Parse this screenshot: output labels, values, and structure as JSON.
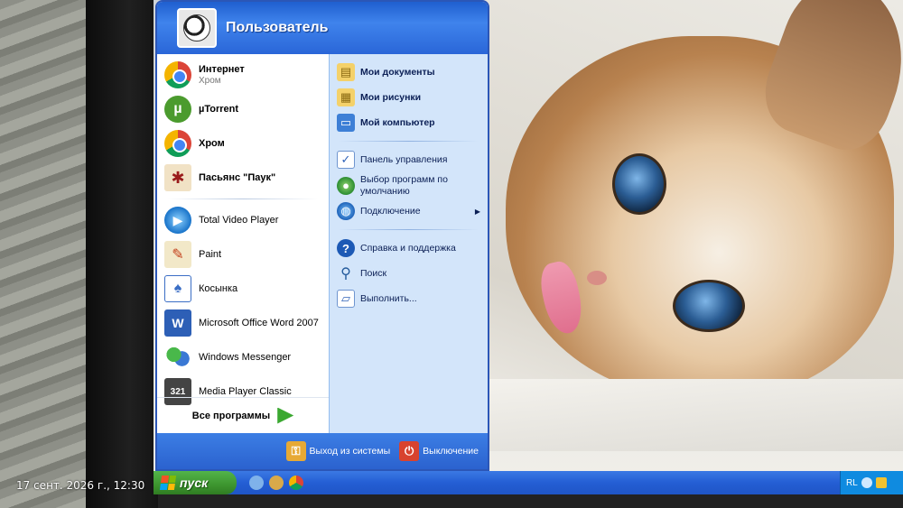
{
  "start_menu": {
    "user_name": "Пользователь",
    "pinned": [
      {
        "title": "Интернет",
        "subtitle": "Хром",
        "icon": "chrome-icon"
      },
      {
        "title": "µTorrent",
        "icon": "utorrent-icon"
      },
      {
        "title": "Хром",
        "icon": "chrome-icon"
      },
      {
        "title": "Пасьянс \"Паук\"",
        "icon": "spider-solitaire-icon"
      }
    ],
    "recent": [
      {
        "title": "Total Video Player",
        "icon": "video-player-icon"
      },
      {
        "title": "Paint",
        "icon": "paint-icon"
      },
      {
        "title": "Косынка",
        "icon": "solitaire-icon"
      },
      {
        "title": "Microsoft Office Word 2007",
        "icon": "word-icon"
      },
      {
        "title": "Windows Messenger",
        "icon": "messenger-icon"
      },
      {
        "title": "Media Player Classic",
        "icon": "media-player-icon"
      }
    ],
    "all_programs": "Все программы",
    "places": [
      {
        "label": "Мои документы",
        "icon": "documents-folder-icon"
      },
      {
        "label": "Мои рисунки",
        "icon": "pictures-folder-icon"
      },
      {
        "label": "Мой компьютер",
        "icon": "computer-icon"
      }
    ],
    "system": [
      {
        "label": "Панель управления",
        "icon": "control-panel-icon"
      },
      {
        "label": "Выбор программ по умолчанию",
        "icon": "default-programs-icon"
      },
      {
        "label": "Подключение",
        "icon": "network-connection-icon"
      }
    ],
    "help": [
      {
        "label": "Справка и поддержка",
        "icon": "help-icon"
      },
      {
        "label": "Поиск",
        "icon": "search-icon"
      },
      {
        "label": "Выполнить...",
        "icon": "run-icon"
      }
    ],
    "logoff": "Выход из системы",
    "shutdown": "Выключение"
  },
  "taskbar": {
    "start_label": "пуск",
    "language": "RL"
  },
  "photo_datestamp": "17 сент. 2026 г., 12:30",
  "colors": {
    "menu_blue": "#2b62cf",
    "menu_right_panel": "#d3e5fa",
    "start_green": "#3d952f",
    "taskbar_blue": "#245ed4"
  }
}
